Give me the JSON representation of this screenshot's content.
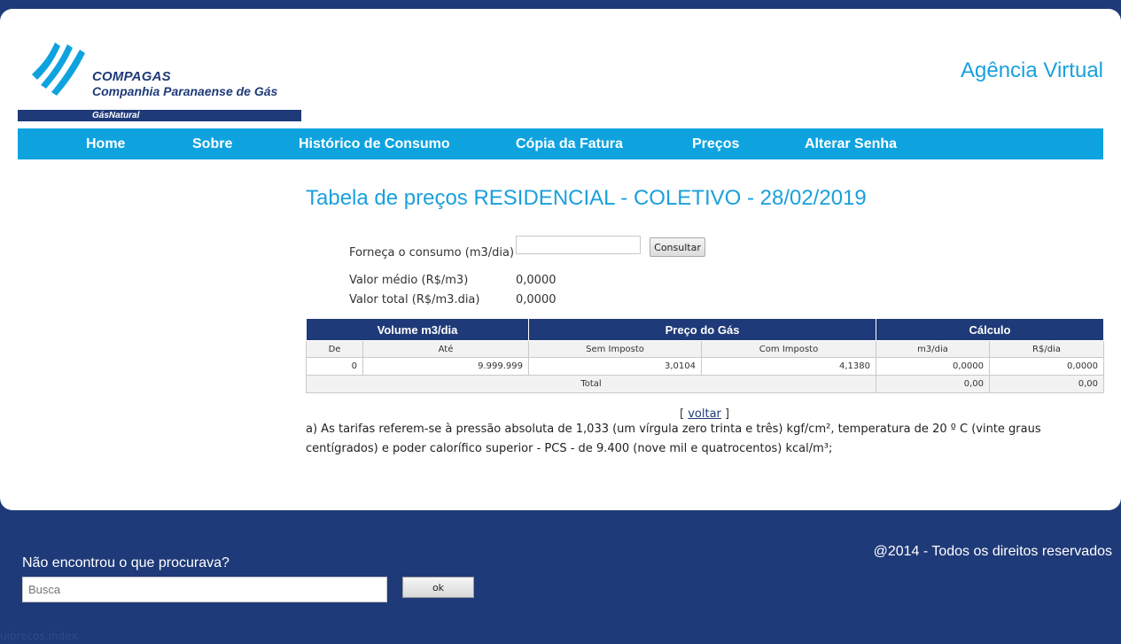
{
  "brand": {
    "name": "COMPAGAS",
    "full_name": "Companhia Paranaense de Gás",
    "tagline": "GásNatural",
    "colors": {
      "navy": "#1f3a78",
      "cyan": "#0ea3df"
    }
  },
  "header": {
    "agency_title": "Agência Virtual"
  },
  "nav": {
    "items": [
      {
        "label": "Home"
      },
      {
        "label": "Sobre"
      },
      {
        "label": "Histórico de Consumo"
      },
      {
        "label": "Cópia da Fatura"
      },
      {
        "label": "Preços"
      },
      {
        "label": "Alterar Senha"
      }
    ]
  },
  "page": {
    "title": "Tabela de preços RESIDENCIAL - COLETIVO - 28/02/2019"
  },
  "form": {
    "consumption_label": "Forneça o consumo (m3/dia)",
    "consumption_value": "",
    "consult_button": "Consultar",
    "avg_label": "Valor médio (R$/m3)",
    "avg_value": "0,0000",
    "total_label": "Valor total (R$/m3.dia)",
    "total_value": "0,0000"
  },
  "table": {
    "groups": [
      "Volume m3/dia",
      "Preço do Gás",
      "Cálculo"
    ],
    "columns": [
      "De",
      "Até",
      "Sem Imposto",
      "Com Imposto",
      "m3/dia",
      "R$/dia"
    ],
    "rows": [
      [
        "0",
        "9.999.999",
        "3,0104",
        "4,1380",
        "0,0000",
        "0,0000"
      ]
    ],
    "total": {
      "label": "Total",
      "m3": "0,00",
      "rs": "0,00"
    }
  },
  "back": {
    "open": "[",
    "link": "voltar",
    "close": "]"
  },
  "note": "a) As tarifas referem-se à pressão absoluta de 1,033 (um vírgula zero trinta e três) kgf/cm², temperatura de 20 º C (vinte graus centígrados) e poder calorífico superior - PCS - de 9.400 (nove mil e quatrocentos) kcal/m³;",
  "footer": {
    "copyright": "@2014 - Todos os direitos reservados",
    "search_label": "Não encontrou o que procurava?",
    "search_placeholder": "Busca",
    "search_button": "ok",
    "page_id": "uiprecos.index"
  }
}
